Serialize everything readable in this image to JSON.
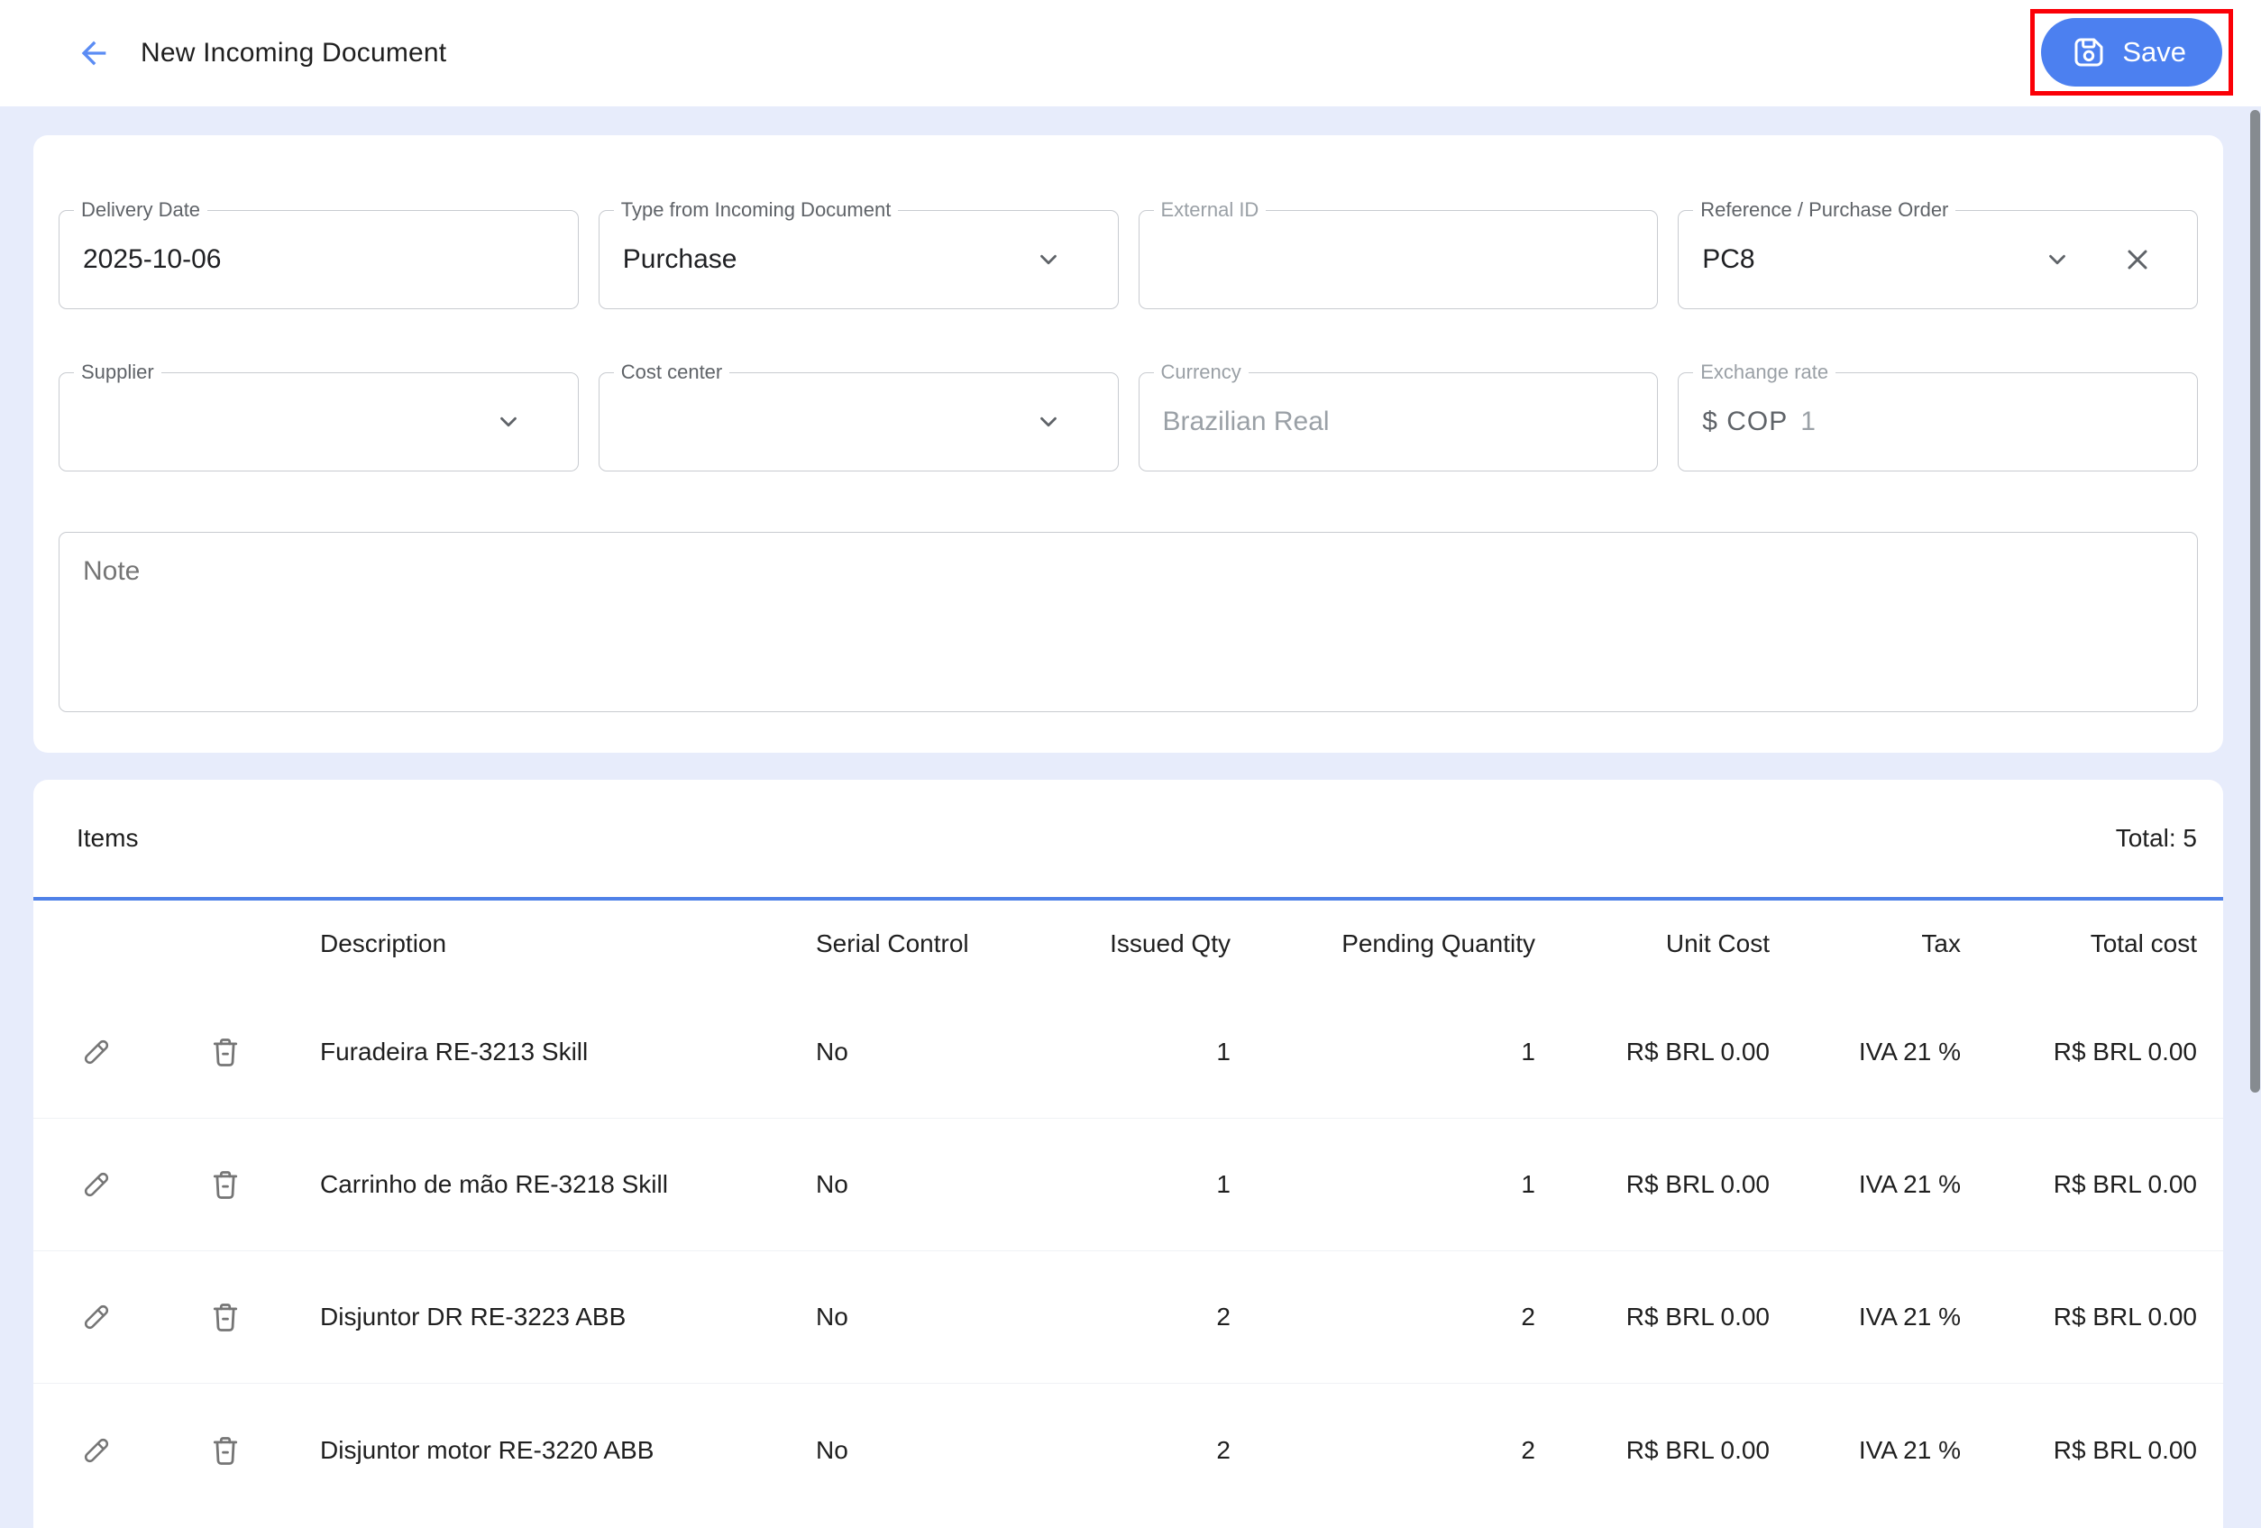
{
  "header": {
    "title": "New Incoming Document",
    "save_label": "Save"
  },
  "form": {
    "fields": [
      {
        "label": "Delivery Date",
        "value": "2025-10-06"
      },
      {
        "label": "Type from Incoming Document",
        "value": "Purchase"
      },
      {
        "label": "External ID",
        "value": ""
      },
      {
        "label": "Reference / Purchase Order",
        "value": "PC8"
      },
      {
        "label": "Supplier",
        "value": ""
      },
      {
        "label": "Cost center",
        "value": ""
      },
      {
        "label": "Currency",
        "placeholder": "Brazilian Real"
      },
      {
        "label": "Exchange rate",
        "prefix": "$ COP",
        "value": "1"
      }
    ],
    "note_placeholder": "Note"
  },
  "items": {
    "title": "Items",
    "total_label": "Total: 5",
    "columns": [
      "Description",
      "Serial Control",
      "Issued Qty",
      "Pending Quantity",
      "Unit Cost",
      "Tax",
      "Total cost"
    ],
    "rows": [
      {
        "description": "Furadeira RE-3213 Skill",
        "serial_control": "No",
        "issued_qty": "1",
        "pending_qty": "1",
        "unit_cost": "R$ BRL 0.00",
        "tax": "IVA 21 %",
        "total_cost": "R$ BRL 0.00"
      },
      {
        "description": "Carrinho de mão RE-3218 Skill",
        "serial_control": "No",
        "issued_qty": "1",
        "pending_qty": "1",
        "unit_cost": "R$ BRL 0.00",
        "tax": "IVA 21 %",
        "total_cost": "R$ BRL 0.00"
      },
      {
        "description": "Disjuntor DR RE-3223 ABB",
        "serial_control": "No",
        "issued_qty": "2",
        "pending_qty": "2",
        "unit_cost": "R$ BRL 0.00",
        "tax": "IVA 21 %",
        "total_cost": "R$ BRL 0.00"
      },
      {
        "description": "Disjuntor motor RE-3220 ABB",
        "serial_control": "No",
        "issued_qty": "2",
        "pending_qty": "2",
        "unit_cost": "R$ BRL 0.00",
        "tax": "IVA 21 %",
        "total_cost": "R$ BRL 0.00"
      }
    ]
  },
  "colors": {
    "accent_blue": "#4c80f0",
    "back_arrow_blue": "#5b8cf4",
    "highlight_red": "#fb0007",
    "items_divider_blue": "#4f81e8",
    "page_background": "#e7ecfb",
    "scrollbar_thumb": "#868b90",
    "icon_gray": "#757575"
  }
}
